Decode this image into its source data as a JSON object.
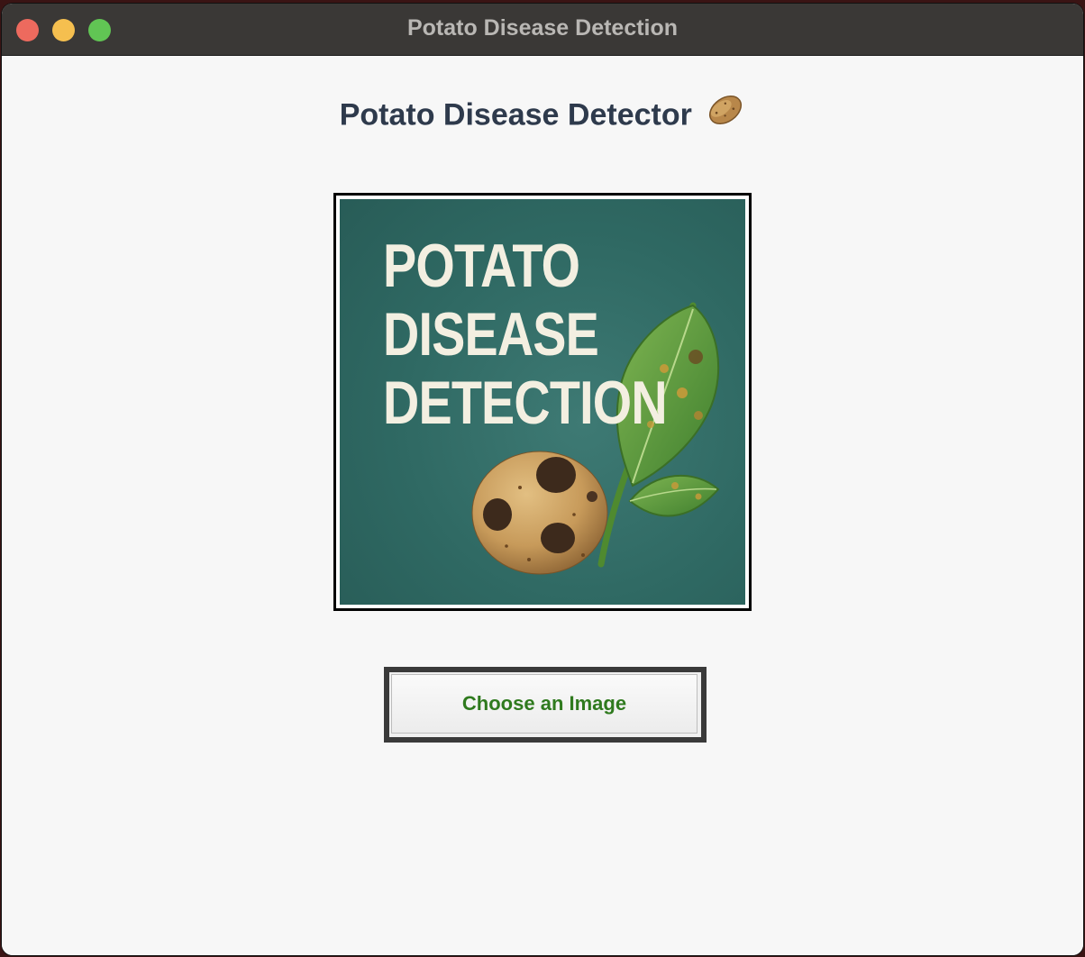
{
  "window": {
    "title": "Potato Disease Detection",
    "traffic_lights": {
      "close_color": "#ed6a5e",
      "minimize_color": "#f5bf4f",
      "maximize_color": "#61c554"
    }
  },
  "main": {
    "heading": "Potato Disease Detector",
    "heading_icon": "potato-icon",
    "preview_image": {
      "banner_lines": [
        "POTATO",
        "DISEASE",
        "DETECTION"
      ],
      "background_color": "#2f6963"
    },
    "choose_button_label": "Choose an Image",
    "choose_button_color": "#2f7a1e"
  }
}
